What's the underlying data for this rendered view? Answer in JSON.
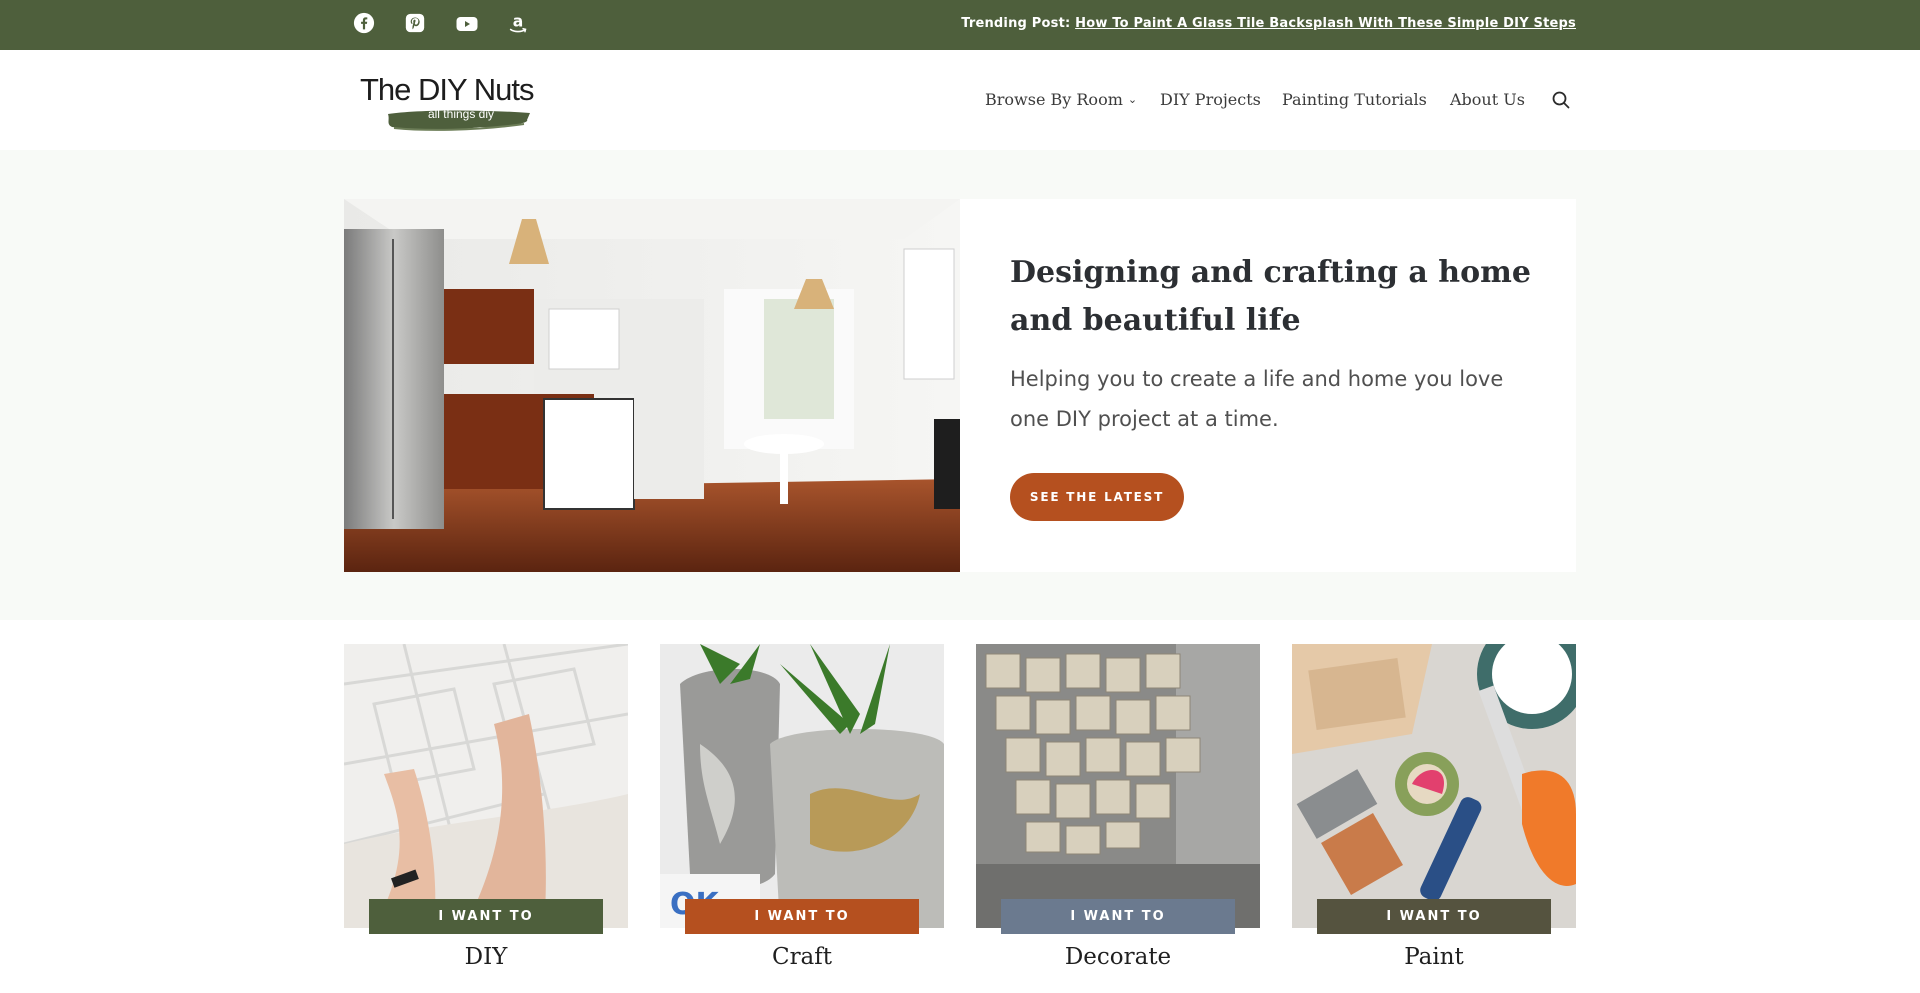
{
  "topbar": {
    "social_icons": [
      "facebook-icon",
      "pinterest-icon",
      "youtube-icon",
      "amazon-icon"
    ],
    "trending_label": "Trending Post:",
    "trending_link": "How To Paint A Glass Tile Backsplash With These Simple DIY Steps"
  },
  "header": {
    "logo_title": "The DIY Nuts",
    "logo_tagline": "all things diy",
    "nav": [
      {
        "label": "Browse By Room",
        "has_dropdown": true
      },
      {
        "label": "DIY Projects"
      },
      {
        "label": "Painting Tutorials"
      },
      {
        "label": "About Us"
      }
    ],
    "search_icon": "search-icon"
  },
  "hero": {
    "title": "Designing and crafting a home and beautiful life",
    "subtitle": "Helping you to create a life and home you love one DIY project at a time.",
    "button_label": "SEE THE LATEST"
  },
  "categories": [
    {
      "pill": "I WANT TO",
      "title": "DIY",
      "pill_color": "#4e5f3c"
    },
    {
      "pill": "I WANT TO",
      "title": "Craft",
      "pill_color": "#b5501f"
    },
    {
      "pill": "I WANT TO",
      "title": "Decorate",
      "pill_color": "#6b7a8f"
    },
    {
      "pill": "I WANT TO",
      "title": "Paint",
      "pill_color": "#55533f"
    }
  ],
  "colors": {
    "brand_green": "#4e5f3c",
    "accent_orange": "#b5501f",
    "hero_background": "#f8faf7"
  }
}
